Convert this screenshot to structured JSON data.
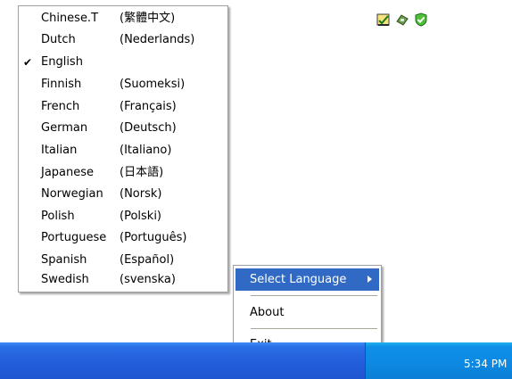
{
  "language_menu": {
    "items": [
      {
        "name": "Chinese.T",
        "native": "(繁體中文)",
        "checked": false
      },
      {
        "name": "Dutch",
        "native": "(Nederlands)",
        "checked": false
      },
      {
        "name": "English",
        "native": "",
        "checked": true
      },
      {
        "name": "Finnish",
        "native": "(Suomeksi)",
        "checked": false
      },
      {
        "name": "French",
        "native": "(Français)",
        "checked": false
      },
      {
        "name": "German",
        "native": "(Deutsch)",
        "checked": false
      },
      {
        "name": "Italian",
        "native": "(Italiano)",
        "checked": false
      },
      {
        "name": "Japanese",
        "native": "(日本語)",
        "checked": false
      },
      {
        "name": "Norwegian",
        "native": "(Norsk)",
        "checked": false
      },
      {
        "name": "Polish",
        "native": "(Polski)",
        "checked": false
      },
      {
        "name": "Portuguese",
        "native": "(Português)",
        "checked": false
      },
      {
        "name": "Spanish",
        "native": "(Español)",
        "checked": false
      },
      {
        "name": "Swedish",
        "native": "(svenska)",
        "checked": false
      }
    ],
    "check_glyph": "✔"
  },
  "tray_menu": {
    "select_language": "Select Language",
    "about": "About",
    "exit": "Exit",
    "highlight_color": "#316ac5"
  },
  "taskbar": {
    "clock": "5:34 PM",
    "tray_icons": [
      "app-tray-icon",
      "network-tray-icon",
      "security-shield-icon"
    ]
  }
}
